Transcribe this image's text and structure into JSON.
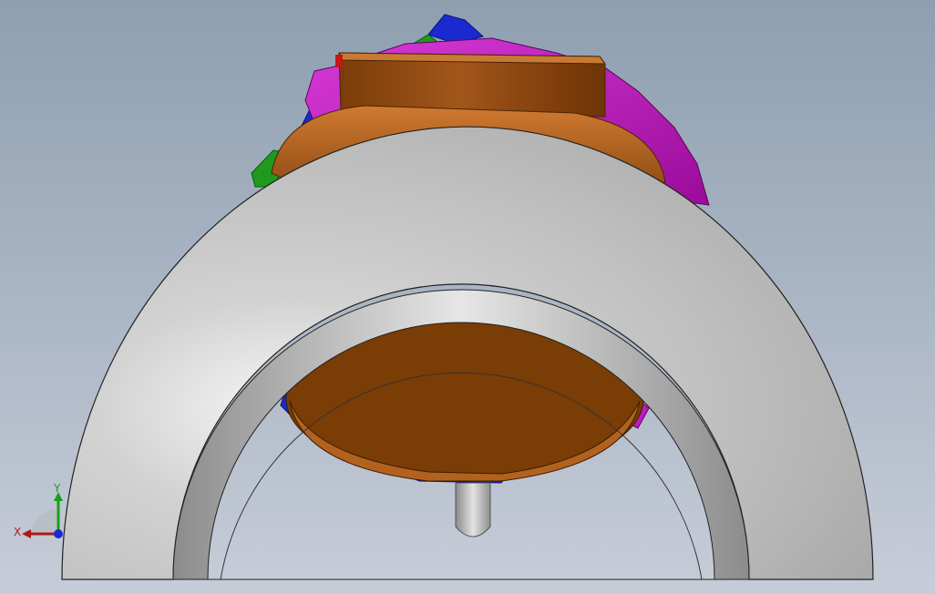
{
  "viewport": {
    "background_top": "#8e9fb0",
    "background_bottom": "#c7cdd8"
  },
  "model": {
    "part_colors": {
      "silver_arch": "#c8c8c8",
      "brown_body": "#8b4a12",
      "magenta_body": "#c21ac2",
      "blue_part": "#1a2ad0",
      "green_part": "#1f9a1f"
    }
  },
  "triad": {
    "x_label": "X",
    "y_label": "Y",
    "x_color": "#b01818",
    "y_color": "#18a018",
    "z_color": "#1a2ad0"
  }
}
